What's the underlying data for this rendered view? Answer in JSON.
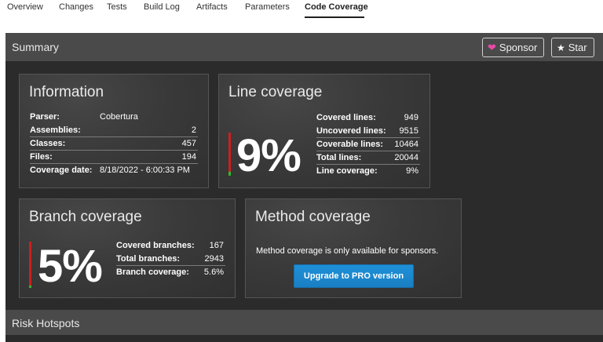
{
  "tabs": [
    {
      "label": "Overview"
    },
    {
      "label": "Changes"
    },
    {
      "label": "Tests"
    },
    {
      "label": "Build Log"
    },
    {
      "label": "Artifacts"
    },
    {
      "label": "Parameters"
    },
    {
      "label": "Code Coverage",
      "active": true
    }
  ],
  "summary": {
    "title": "Summary",
    "sponsor_label": "Sponsor",
    "star_label": "Star"
  },
  "information": {
    "title": "Information",
    "rows": [
      {
        "key": "Parser:",
        "value": "Cobertura"
      },
      {
        "key": "Assemblies:",
        "value": "2"
      },
      {
        "key": "Classes:",
        "value": "457"
      },
      {
        "key": "Files:",
        "value": "194"
      },
      {
        "key": "Coverage date:",
        "value": "8/18/2022 - 6:00:33 PM"
      }
    ]
  },
  "line_coverage": {
    "title": "Line coverage",
    "percent_label": "9%",
    "percent": 9,
    "rows": [
      {
        "key": "Covered lines:",
        "value": "949"
      },
      {
        "key": "Uncovered lines:",
        "value": "9515"
      },
      {
        "key": "Coverable lines:",
        "value": "10464"
      },
      {
        "key": "Total lines:",
        "value": "20044"
      },
      {
        "key": "Line coverage:",
        "value": "9%"
      }
    ]
  },
  "branch_coverage": {
    "title": "Branch coverage",
    "percent_label": "5%",
    "percent": 5.6,
    "rows": [
      {
        "key": "Covered branches:",
        "value": "167"
      },
      {
        "key": "Total branches:",
        "value": "2943"
      },
      {
        "key": "Branch coverage:",
        "value": "5.6%"
      }
    ]
  },
  "method_coverage": {
    "title": "Method coverage",
    "message": "Method coverage is only available for sponsors.",
    "button_label": "Upgrade to PRO version"
  },
  "risk_hotspots": {
    "title": "Risk Hotspots"
  },
  "colors": {
    "covered": "#2eb82e",
    "uncovered": "#cc1f1f",
    "sponsor_heart": "#ea4aaa",
    "button_blue": "#1e90d8"
  }
}
